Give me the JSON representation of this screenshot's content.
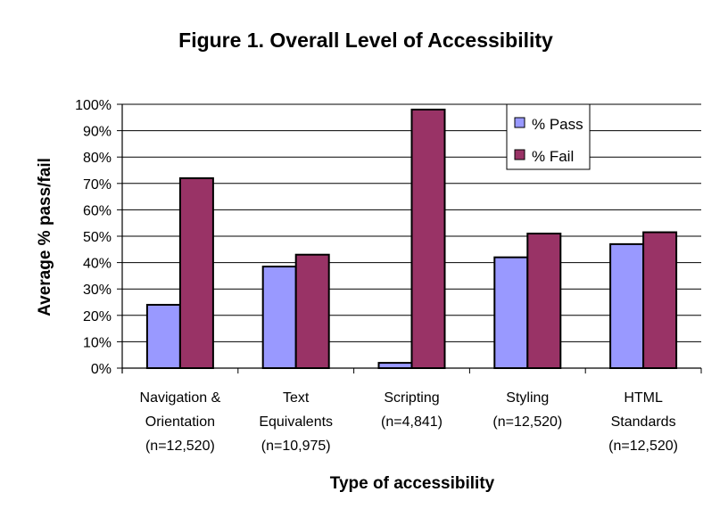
{
  "chart_data": {
    "type": "bar",
    "title": "Figure 1. Overall Level of Accessibility",
    "xlabel": "Type of accessibility",
    "ylabel": "Average % pass/fail",
    "ylim": [
      0,
      100
    ],
    "yticks": [
      "0%",
      "10%",
      "20%",
      "30%",
      "40%",
      "50%",
      "60%",
      "70%",
      "80%",
      "90%",
      "100%"
    ],
    "grid": true,
    "legend_position": "top-right",
    "categories": [
      [
        "Navigation &",
        "Orientation",
        "(n=12,520)"
      ],
      [
        "Text",
        "Equivalents",
        "(n=10,975)"
      ],
      [
        "Scripting",
        "(n=4,841)"
      ],
      [
        "Styling",
        "(n=12,520)"
      ],
      [
        "HTML",
        "Standards",
        "(n=12,520)"
      ]
    ],
    "series": [
      {
        "name": "% Pass",
        "color": "#9999ff",
        "values": [
          24,
          38.5,
          2,
          42,
          47
        ]
      },
      {
        "name": "% Fail",
        "color": "#993366",
        "values": [
          72,
          43,
          98,
          51,
          51.5
        ]
      }
    ]
  }
}
